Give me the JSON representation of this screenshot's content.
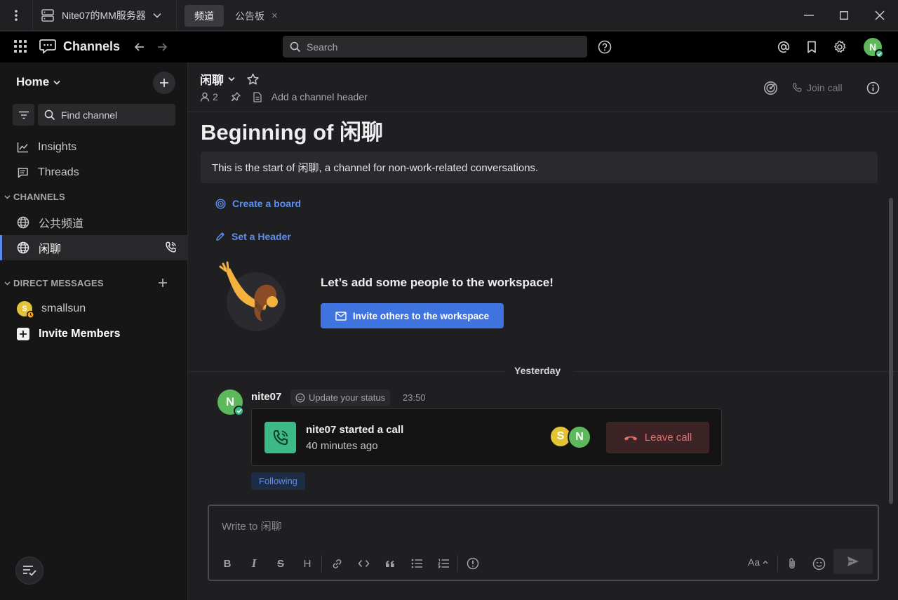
{
  "titlebar": {
    "server_name": "Nite07的MM服务器",
    "tabs": [
      {
        "label": "频道"
      },
      {
        "label": "公告板",
        "close": "×"
      }
    ]
  },
  "header": {
    "product": "Channels",
    "search_placeholder": "Search",
    "user_initial": "N"
  },
  "sidebar": {
    "team_name": "Home",
    "find_channel": "Find channel",
    "nav": [
      {
        "label": "Insights",
        "icon": "insights-icon"
      },
      {
        "label": "Threads",
        "icon": "threads-icon"
      }
    ],
    "channels_heading": "CHANNELS",
    "channels": [
      {
        "label": "公共频道",
        "icon": "globe-icon",
        "active": false
      },
      {
        "label": "闲聊",
        "icon": "globe-icon",
        "active": true
      }
    ],
    "dm_heading": "DIRECT MESSAGES",
    "dms": [
      {
        "label": "smallsun",
        "initial": "S"
      }
    ],
    "invite_members": "Invite Members"
  },
  "channel": {
    "name": "闲聊",
    "member_count": "2",
    "header_placeholder": "Add a channel header",
    "join_call": "Join call",
    "beginning_title": "Beginning of 闲聊",
    "intro": "This is the start of 闲聊, a channel for non-work-related conversations.",
    "create_board": "Create a board",
    "set_header": "Set a Header",
    "invite_title": "Let’s add some people to the workspace!",
    "invite_button": "Invite others to the workspace",
    "day_separator": "Yesterday"
  },
  "post": {
    "author": "nite07",
    "author_initial": "N",
    "status_chip": "Update your status",
    "time": "23:50",
    "call_title": "nite07 started a call",
    "call_time": "40 minutes ago",
    "participants": [
      "S",
      "N"
    ],
    "leave_call": "Leave call",
    "following": "Following"
  },
  "composer": {
    "placeholder": "Write to 闲聊",
    "format_items": [
      "B",
      "I",
      "S",
      "H"
    ],
    "text_size": "Aa"
  },
  "colors": {
    "accent": "#3f74e0",
    "link": "#5d8fee",
    "online": "#3db887",
    "avatar_n": "#5db85c",
    "avatar_s": "#e2c335",
    "danger": "#e46e6b"
  }
}
